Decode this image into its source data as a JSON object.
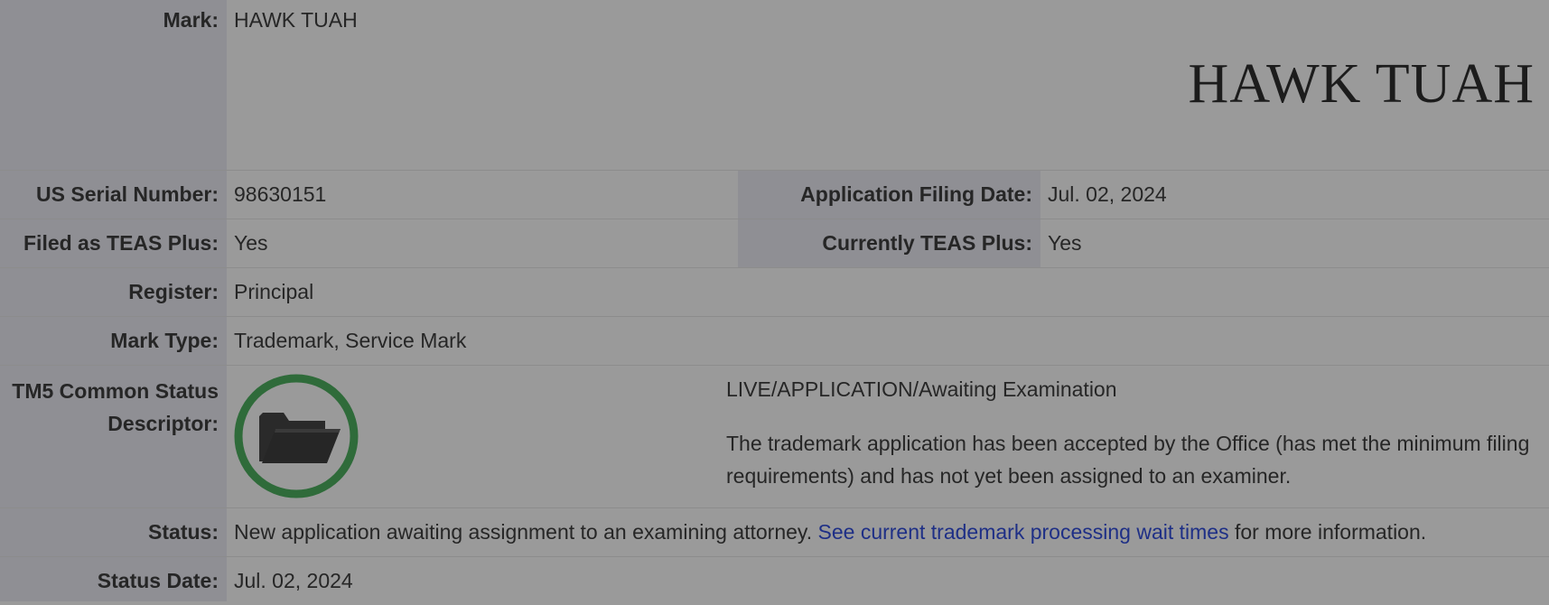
{
  "fields": {
    "mark_label": "Mark:",
    "mark_value": "HAWK TUAH",
    "mark_image_text": "HAWK TUAH",
    "serial_label": "US Serial Number:",
    "serial_value": "98630151",
    "filing_date_label": "Application Filing Date:",
    "filing_date_value": "Jul. 02, 2024",
    "teas_filed_label": "Filed as TEAS Plus:",
    "teas_filed_value": "Yes",
    "teas_current_label": "Currently TEAS Plus:",
    "teas_current_value": "Yes",
    "register_label": "Register:",
    "register_value": "Principal",
    "mark_type_label": "Mark Type:",
    "mark_type_value": "Trademark, Service Mark",
    "tm5_label_line1": "TM5 Common Status",
    "tm5_label_line2": "Descriptor:",
    "tm5_status_title": "LIVE/APPLICATION/Awaiting Examination",
    "tm5_status_description": "The trademark application has been accepted by the Office (has met the minimum filing requirements) and has not yet been assigned to an examiner.",
    "status_label": "Status:",
    "status_text_before": "New application awaiting assignment to an examining attorney. ",
    "status_link": "See current trademark processing wait times",
    "status_text_after": " for more information.",
    "status_date_label": "Status Date:",
    "status_date_value": "Jul. 02, 2024"
  },
  "icons": {
    "status_icon": "folder-open-icon",
    "status_ring_color": "#2f6b3a"
  },
  "colors": {
    "background": "#9a9a9a",
    "label_column": "#8f8f94",
    "link": "#1e2f86"
  }
}
